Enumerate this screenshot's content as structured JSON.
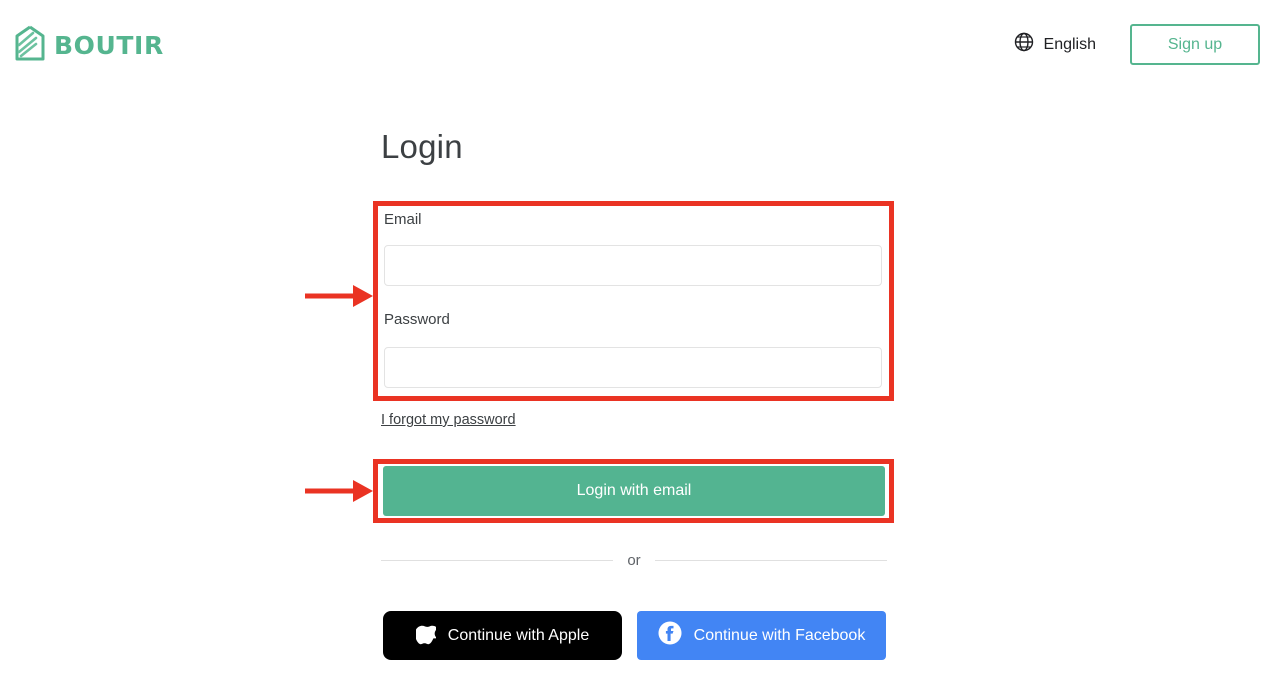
{
  "header": {
    "brand_name": "BOUTIR",
    "brand_icon": "boutir-house-logo-icon",
    "language": {
      "icon": "globe-icon",
      "label": "English"
    },
    "signup_label": "Sign up"
  },
  "main": {
    "title": "Login",
    "email": {
      "label": "Email",
      "value": "",
      "placeholder": ""
    },
    "password": {
      "label": "Password",
      "value": "",
      "placeholder": ""
    },
    "forgot_password_label": "I forgot my password",
    "login_button_label": "Login with email",
    "divider_label": "or",
    "social": [
      {
        "label": "Continue with Apple",
        "icon": "apple-icon",
        "background": "#000000"
      },
      {
        "label": "Continue with Facebook",
        "icon": "facebook-icon",
        "background": "#4285f4"
      }
    ]
  },
  "colors": {
    "brand_green": "#55b58f",
    "button_green": "#53b491",
    "annotation_red": "#ea3323",
    "facebook_blue": "#4285f4"
  },
  "annotations": {
    "fields_highlight": "credential-fields-highlight",
    "login_highlight": "login-button-highlight",
    "arrow_fields": "arrow-pointing-to-credential-fields",
    "arrow_login": "arrow-pointing-to-login-button"
  }
}
